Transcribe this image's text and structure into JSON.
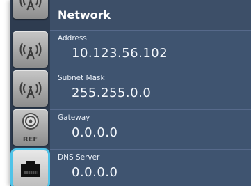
{
  "header": {
    "title": "Network"
  },
  "fields": [
    {
      "label": "Address",
      "value": "10.123.56.102"
    },
    {
      "label": "Subnet Mask",
      "value": "255.255.0.0"
    },
    {
      "label": "Gateway",
      "value": "0.0.0.0"
    },
    {
      "label": "DNS Server",
      "value": "0.0.0.0"
    }
  ],
  "sidebar": {
    "items": [
      {
        "icon": "antenna-icon"
      },
      {
        "icon": "antenna-icon"
      },
      {
        "icon": "antenna-icon"
      },
      {
        "icon": "bnc-connector-icon",
        "label": "REF"
      },
      {
        "icon": "ethernet-port-icon",
        "active": true
      }
    ]
  },
  "colors": {
    "panel_bg": "#3a4b62",
    "sidebar_bg": "#2e3c50",
    "field_bg": "#3f5470",
    "active_highlight": "#4fc3e8",
    "text": "#ffffff"
  }
}
